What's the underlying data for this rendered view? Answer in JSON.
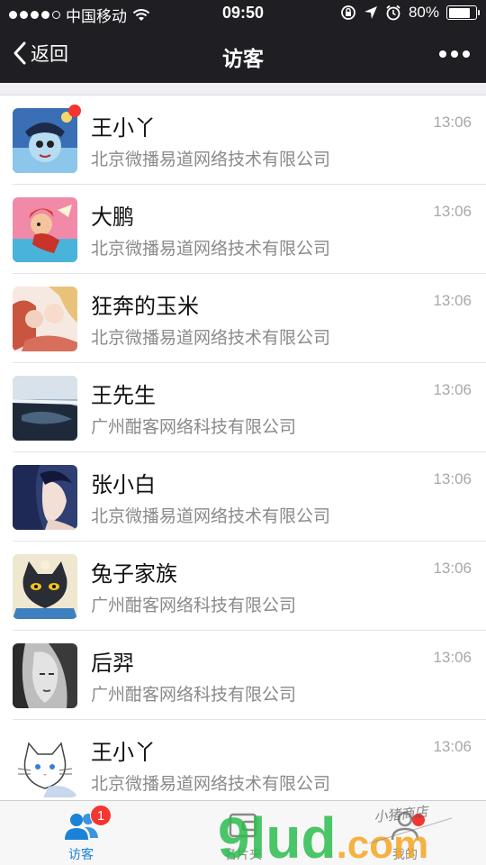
{
  "status_bar": {
    "carrier": "中国移动",
    "time": "09:50",
    "battery": "80%",
    "battery_level": 0.8
  },
  "nav": {
    "back_label": "返回",
    "title": "访客"
  },
  "visitors": [
    {
      "name": "王小丫",
      "company": "北京微播易道网络技术有限公司",
      "time": "13:06",
      "unread": true
    },
    {
      "name": "大鹏",
      "company": "北京微播易道网络技术有限公司",
      "time": "13:06",
      "unread": false
    },
    {
      "name": "狂奔的玉米",
      "company": "北京微播易道网络技术有限公司",
      "time": "13:06",
      "unread": false
    },
    {
      "name": "王先生",
      "company": "广州酣客网络科技有限公司",
      "time": "13:06",
      "unread": false
    },
    {
      "name": "张小白",
      "company": "北京微播易道网络技术有限公司",
      "time": "13:06",
      "unread": false
    },
    {
      "name": "兔子家族",
      "company": "广州酣客网络科技有限公司",
      "time": "13:06",
      "unread": false
    },
    {
      "name": "后羿",
      "company": "广州酣客网络科技有限公司",
      "time": "13:06",
      "unread": false
    },
    {
      "name": "王小丫",
      "company": "北京微播易道网络技术有限公司",
      "time": "13:06",
      "unread": false
    }
  ],
  "tabs": [
    {
      "label": "访客",
      "badge": "1",
      "active": true
    },
    {
      "label": "名片夹",
      "active": false
    },
    {
      "label": "我的",
      "dot": true,
      "active": false
    }
  ],
  "watermark": {
    "brand": "9lud.com",
    "handwriting": "小猪商店"
  },
  "colors": {
    "nav_bg": "#1f1f23",
    "accent": "#1a82d8",
    "badge": "#f43530",
    "watermark_green": "#2dbd4e",
    "watermark_orange": "#f5a623"
  }
}
